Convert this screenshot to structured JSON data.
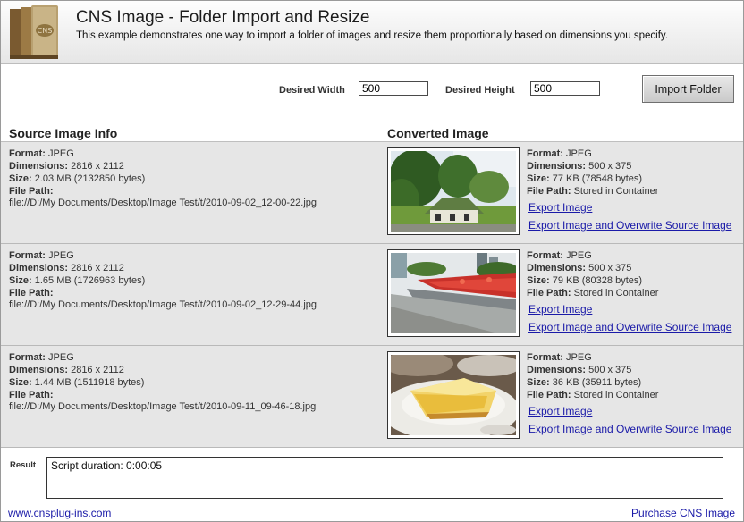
{
  "header": {
    "title": "CNS Image - Folder Import and Resize",
    "subtitle": "This example demonstrates one way to import a folder of images and resize them proportionally based on dimensions you specify."
  },
  "controls": {
    "width_label": "Desired Width",
    "width_value": "500",
    "height_label": "Desired Height",
    "height_value": "500",
    "import_button": "Import Folder"
  },
  "columns": {
    "source": "Source Image Info",
    "converted": "Converted Image"
  },
  "field_labels": {
    "format": "Format:",
    "dimensions": "Dimensions:",
    "size": "Size:",
    "file_path": "File Path:"
  },
  "rows": [
    {
      "source": {
        "format": "JPEG",
        "dimensions": "2816 x 2112",
        "size": "2.03 MB (2132850 bytes)",
        "path": "file://D:/My Documents/Desktop/Image Test/t/2010-09-02_12-00-22.jpg"
      },
      "converted": {
        "format": "JPEG",
        "dimensions": "500 x 375",
        "size": "77 KB (78548 bytes)",
        "path": "Stored in Container"
      },
      "thumb_icon": "garden-photo-thumbnail"
    },
    {
      "source": {
        "format": "JPEG",
        "dimensions": "2816 x 2112",
        "size": "1.65 MB (1726963 bytes)",
        "path": "file://D:/My Documents/Desktop/Image Test/t/2010-09-02_12-29-44.jpg"
      },
      "converted": {
        "format": "JPEG",
        "dimensions": "500 x 375",
        "size": "79 KB (80328 bytes)",
        "path": "Stored in Container"
      },
      "thumb_icon": "flowerbed-photo-thumbnail"
    },
    {
      "source": {
        "format": "JPEG",
        "dimensions": "2816 x 2112",
        "size": "1.44 MB (1511918 bytes)",
        "path": "file://D:/My Documents/Desktop/Image Test/t/2010-09-11_09-46-18.jpg"
      },
      "converted": {
        "format": "JPEG",
        "dimensions": "500 x 375",
        "size": "36 KB (35911 bytes)",
        "path": "Stored in Container"
      },
      "thumb_icon": "cake-photo-thumbnail"
    }
  ],
  "links": {
    "export": "Export Image",
    "export_overwrite": "Export Image and Overwrite Source Image"
  },
  "result": {
    "label": "Result",
    "text": "Script duration: 0:00:05"
  },
  "footer": {
    "left_link": "www.cnsplug-ins.com",
    "right_link": "Purchase CNS Image"
  },
  "colors": {
    "link": "#1a1aa8",
    "row_bg": "#e6e6e6",
    "header_bg": "#eeeeee"
  }
}
